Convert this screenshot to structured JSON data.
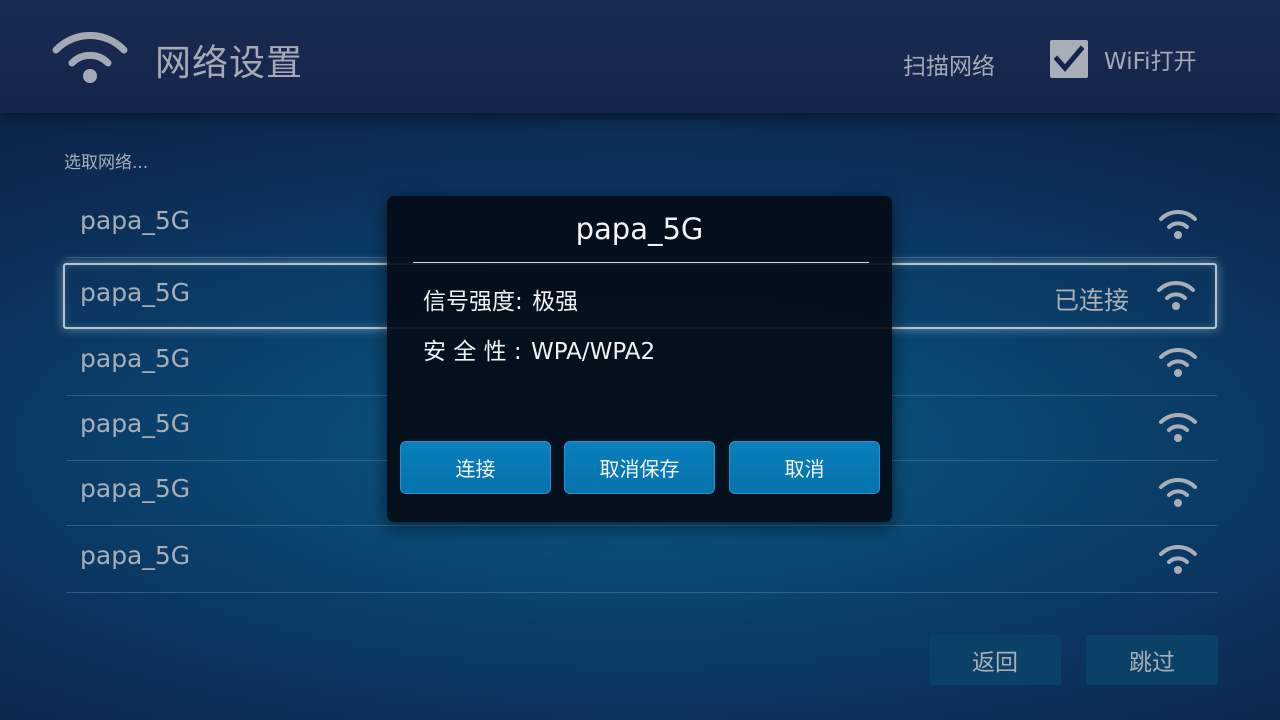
{
  "header": {
    "title": "网络设置",
    "scan_label": "扫描网络",
    "wifi_toggle_label": "WiFi打开",
    "wifi_toggle_checked": true
  },
  "select_hint": "选取网络...",
  "networks": [
    {
      "name": "papa_5G",
      "status": "",
      "selected": false
    },
    {
      "name": "papa_5G",
      "status": "已连接",
      "selected": true
    },
    {
      "name": "papa_5G",
      "status": "",
      "selected": false
    },
    {
      "name": "papa_5G",
      "status": "",
      "selected": false
    },
    {
      "name": "papa_5G",
      "status": "",
      "selected": false
    },
    {
      "name": "papa_5G",
      "status": "",
      "selected": false
    }
  ],
  "dialog": {
    "title": "papa_5G",
    "signal_label": "信号强度:",
    "signal_value": "极强",
    "security_label": "安 全 性 :",
    "security_value": "WPA/WPA2",
    "connect_label": "连接",
    "forget_label": "取消保存",
    "cancel_label": "取消"
  },
  "footer": {
    "back_label": "返回",
    "skip_label": "跳过"
  },
  "icons": {
    "header": "wifi-icon",
    "row": "wifi-signal-icon",
    "checkbox": "checkmark-icon"
  },
  "colors": {
    "accent_button": "#0a7ab5",
    "text_muted": "#a7aeb8",
    "dialog_bg": "#040c16"
  }
}
